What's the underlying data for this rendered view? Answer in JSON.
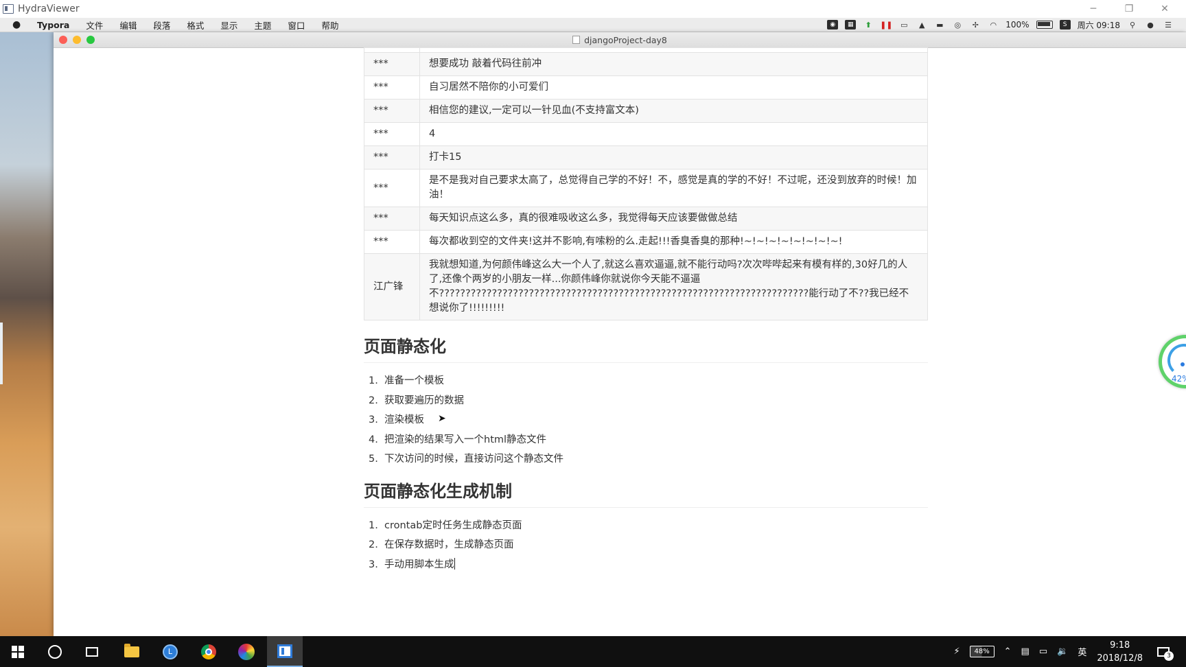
{
  "host_window": {
    "title": "HydraViewer",
    "minimize": "─",
    "restore": "❐",
    "close": "✕"
  },
  "mac_menu": {
    "apple": "",
    "items": [
      "Typora",
      "文件",
      "编辑",
      "段落",
      "格式",
      "显示",
      "主题",
      "窗口",
      "帮助"
    ]
  },
  "mac_status": {
    "battery": "100%",
    "datetime": "周六 09:18"
  },
  "typora": {
    "doc_title": "djangoProject-day8",
    "table": {
      "rows": [
        {
          "user": "***",
          "comment": "想要成功 敲着代码往前冲"
        },
        {
          "user": "***",
          "comment": "自习居然不陪你的小可爱们"
        },
        {
          "user": "***",
          "comment": "相信您的建议,一定可以一针见血(不支持富文本)"
        },
        {
          "user": "***",
          "comment": "4"
        },
        {
          "user": "***",
          "comment": "打卡15"
        },
        {
          "user": "***",
          "comment": "是不是我对自己要求太高了，总觉得自己学的不好！不，感觉是真的学的不好！不过呢，还没到放弃的时候！加油！"
        },
        {
          "user": "***",
          "comment": "每天知识点这么多，真的很难吸收这么多，我觉得每天应该要做做总结"
        },
        {
          "user": "***",
          "comment": "每次都收到空的文件夹!这并不影响,有嗦粉的么.走起!!!香臭香臭的那种!~!~!~!~!~!~!~!~!"
        },
        {
          "user": "江广锋",
          "comment": "我就想知道,为何颜伟峰这么大一个人了,就这么喜欢逼逼,就不能行动吗?次次哔哔起来有模有样的,30好几的人了,还像个两岁的小朋友一样...你颜伟峰你就说你今天能不逼逼不??????????????????????????????????????????????????????????????????????能行动了不??我已经不想说你了!!!!!!!!!"
        }
      ]
    },
    "section1": {
      "heading": "页面静态化",
      "items": [
        {
          "num": "1.",
          "text": "准备一个模板"
        },
        {
          "num": "2.",
          "text": "获取要遍历的数据"
        },
        {
          "num": "3.",
          "text": "渲染模板"
        },
        {
          "num": "4.",
          "text": "把渲染的结果写入一个html静态文件"
        },
        {
          "num": "5.",
          "text": "下次访问的时候，直接访问这个静态文件"
        }
      ]
    },
    "section2": {
      "heading": "页面静态化生成机制",
      "items": [
        {
          "num": "1.",
          "text": "crontab定时任务生成静态页面"
        },
        {
          "num": "2.",
          "text": "在保存数据时，生成静态页面"
        },
        {
          "num": "3.",
          "text": "手动用脚本生成"
        }
      ]
    }
  },
  "speed_widget": {
    "percent": "42%"
  },
  "taskbar": {
    "tray_battery": "48%",
    "ime": "英",
    "time": "9:18",
    "date": "2018/12/8",
    "notifications": "3"
  },
  "colors": {
    "accent_green": "#5fd26a",
    "accent_blue": "#2a7be0",
    "taskbar_bg": "#101010"
  }
}
